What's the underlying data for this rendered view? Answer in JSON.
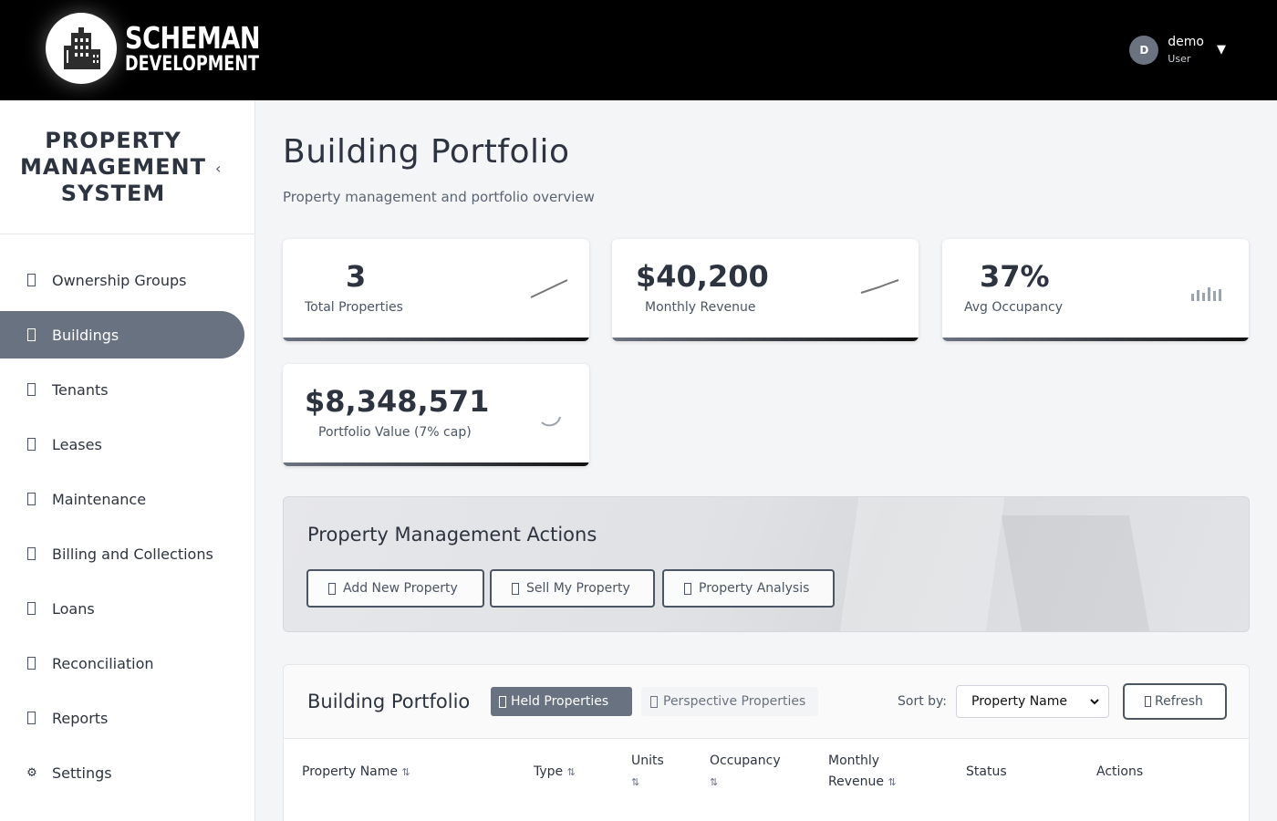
{
  "header": {
    "logo_line1": "SCHEMAN",
    "logo_line2": "DEVELOPMENT",
    "user_initial": "D",
    "user_name": "demo",
    "user_role": "User",
    "dropdown_caret": "▼"
  },
  "sidebar": {
    "title": "PROPERTY MANAGEMENT SYSTEM",
    "collapse_glyph": "‹",
    "items": [
      {
        "label": "Ownership Groups",
        "icon": "building-icon",
        "active": false
      },
      {
        "label": "Buildings",
        "icon": "building-icon",
        "active": true
      },
      {
        "label": "Tenants",
        "icon": "users-icon",
        "active": false
      },
      {
        "label": "Leases",
        "icon": "file-contract-icon",
        "active": false
      },
      {
        "label": "Maintenance",
        "icon": "tools-icon",
        "active": false
      },
      {
        "label": "Billing and Collections",
        "icon": "invoice-icon",
        "active": false
      },
      {
        "label": "Loans",
        "icon": "money-icon",
        "active": false
      },
      {
        "label": "Reconciliation",
        "icon": "balance-icon",
        "active": false
      },
      {
        "label": "Reports",
        "icon": "chart-icon",
        "active": false
      },
      {
        "label": "Settings",
        "icon": "gear-icon",
        "active": false,
        "glyph": "⚙"
      }
    ]
  },
  "page": {
    "title": "Building Portfolio",
    "subtitle": "Property management and portfolio overview"
  },
  "stats": [
    {
      "value": "3",
      "label": "Total Properties",
      "icon": "trend-line-icon"
    },
    {
      "value": "$40,200",
      "label": "Monthly Revenue",
      "icon": "trend-line-icon"
    },
    {
      "value": "37%",
      "label": "Avg Occupancy",
      "icon": "bar-chart-icon"
    },
    {
      "value": "$8,348,571",
      "label": "Portfolio Value (7% cap)",
      "icon": "spinner-icon"
    }
  ],
  "actions": {
    "title": "Property Management Actions",
    "buttons": [
      "Add New Property",
      "Sell My Property",
      "Property Analysis"
    ]
  },
  "portfolio": {
    "title": "Building Portfolio",
    "tab_held": "Held Properties",
    "tab_perspective": "Perspective Properties",
    "sort_label": "Sort by:",
    "sort_value": "Property Name",
    "refresh_label": "Refresh",
    "sort_glyph": "⇅",
    "columns": {
      "name": "Property Name",
      "type": "Type",
      "units": "Units",
      "occupancy": "Occupancy",
      "revenue_1": "Monthly",
      "revenue_2": "Revenue",
      "status": "Status",
      "actions": "Actions"
    }
  },
  "colors": {
    "accent": "#697280",
    "header_bg": "#000000",
    "text": "#2d3440"
  }
}
